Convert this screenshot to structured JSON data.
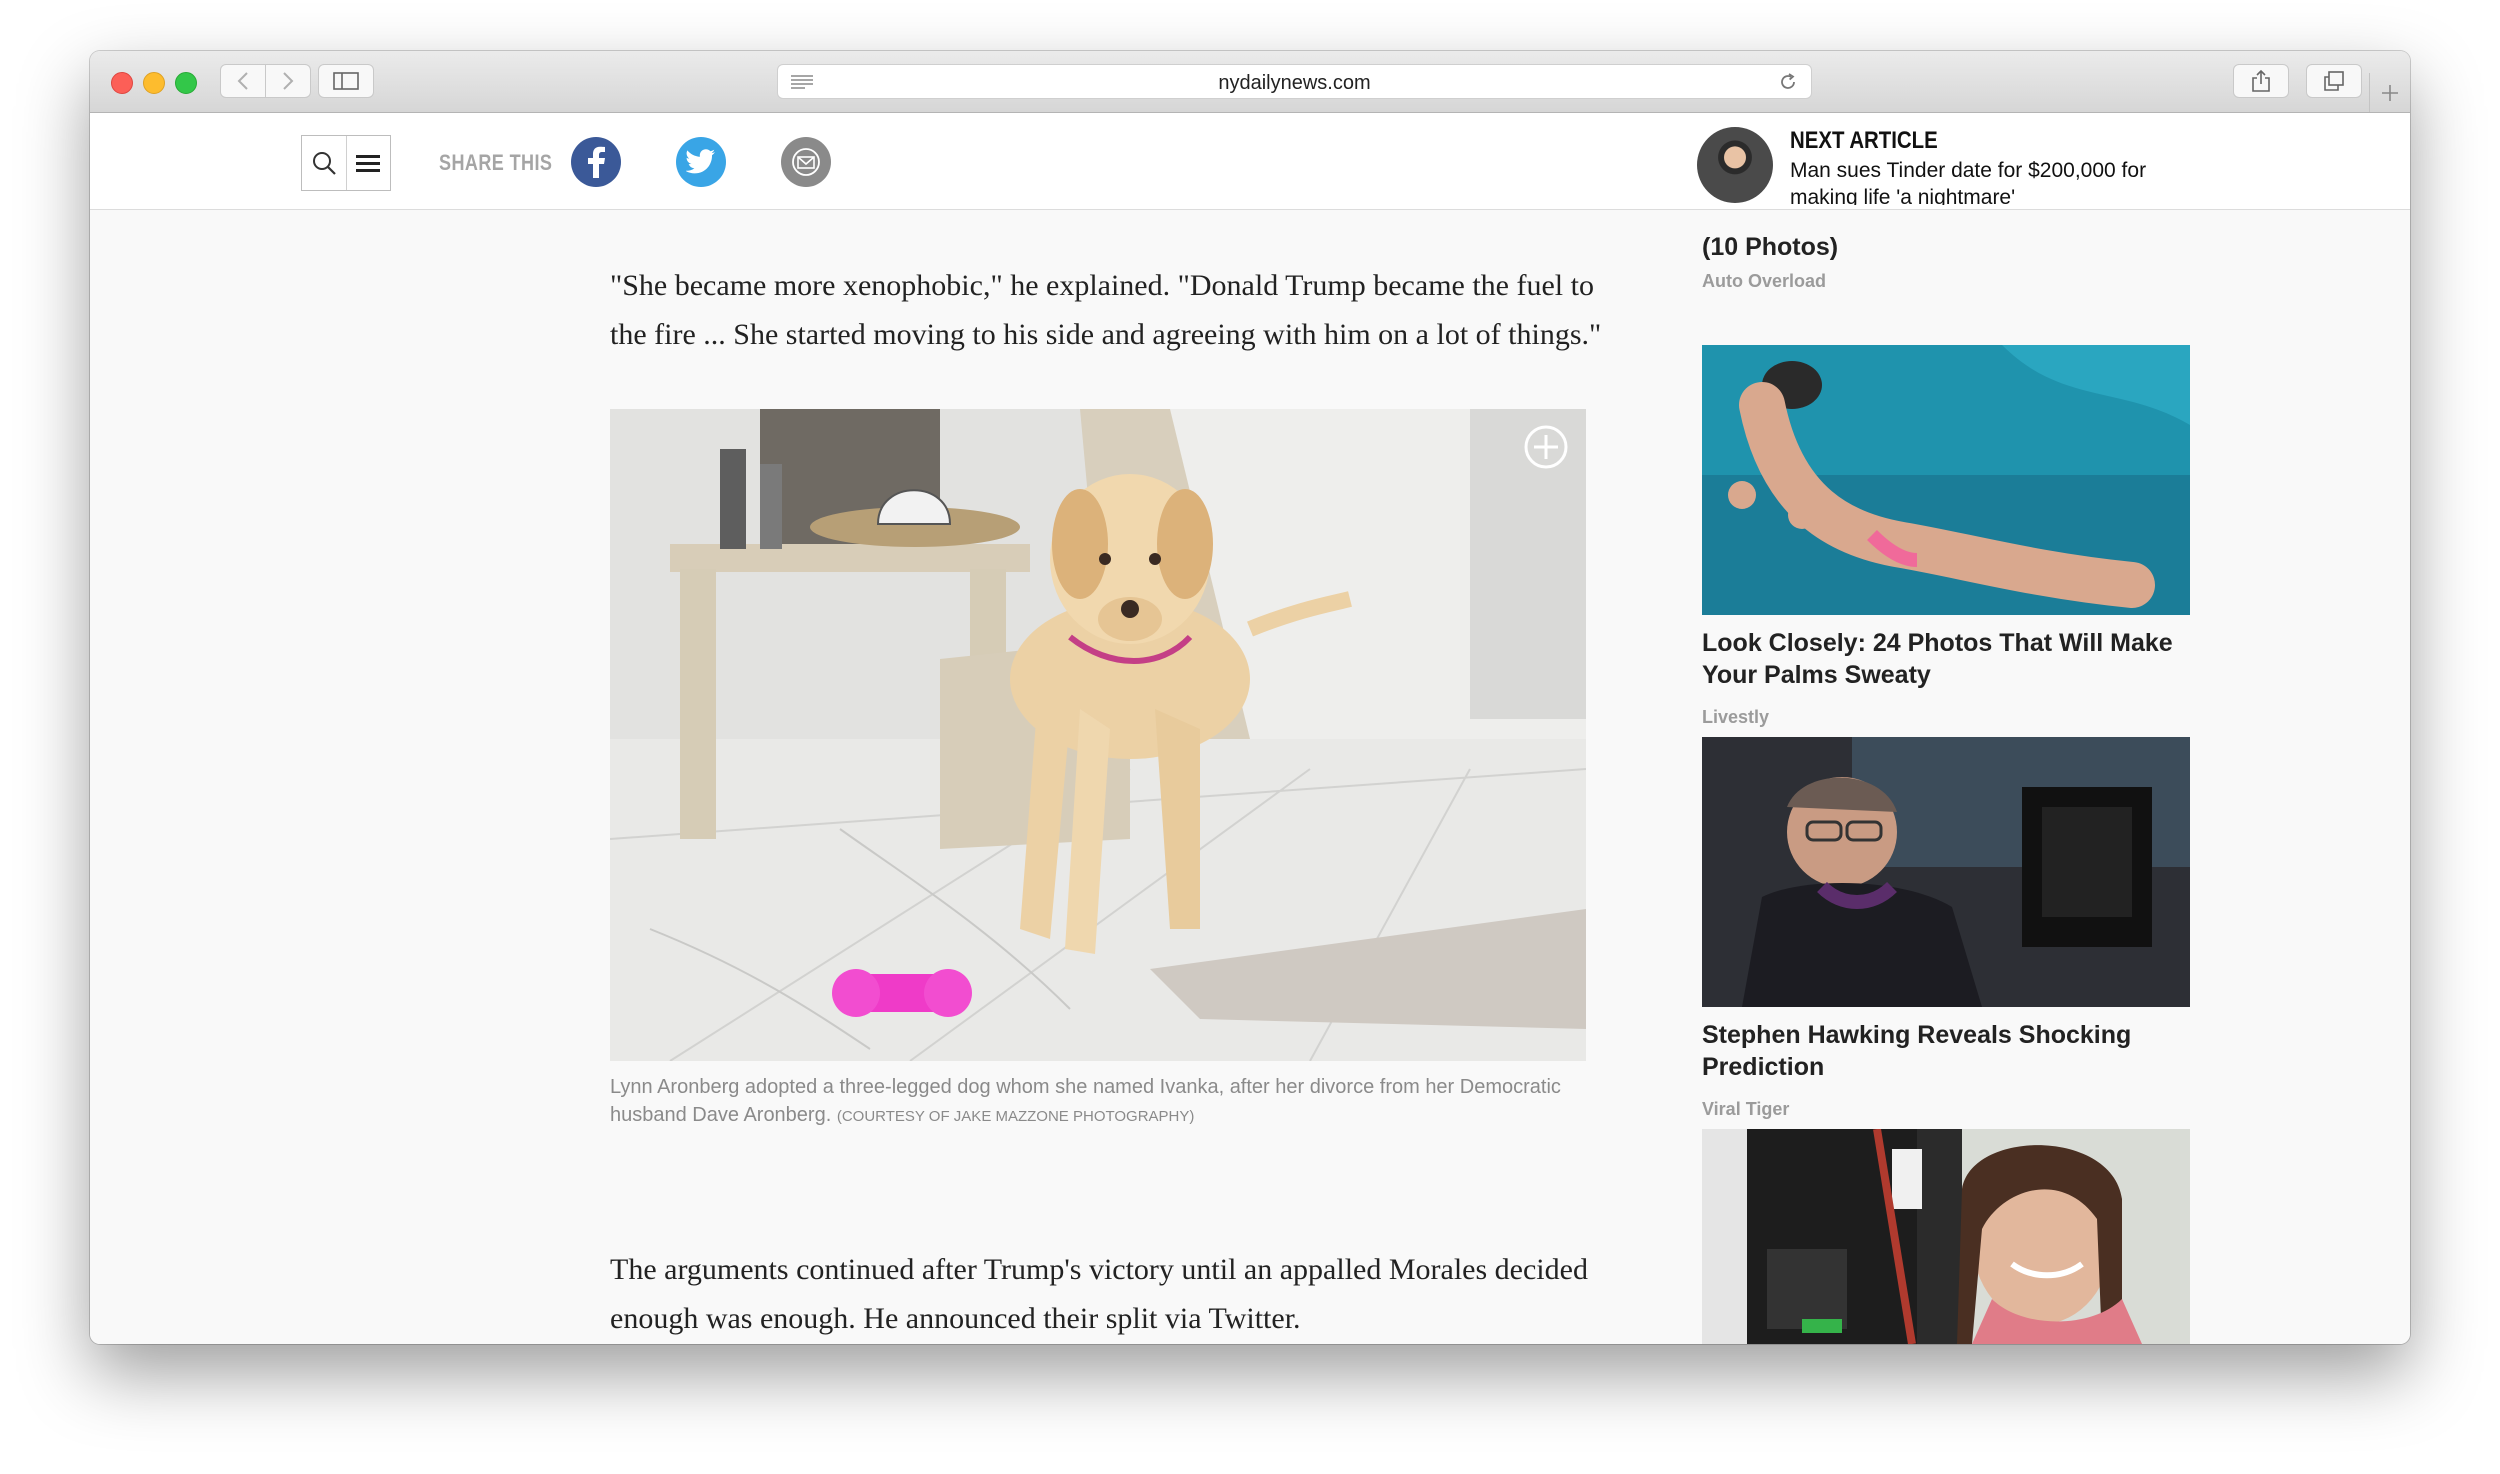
{
  "browser": {
    "url": "nydailynews.com"
  },
  "site_header": {
    "share_label": "SHARE THIS",
    "next_article_label": "NEXT ARTICLE",
    "next_article_title": "Man sues Tinder date for $200,000 for making life 'a nightmare'",
    "brand_colors": {
      "facebook": "#3b5998",
      "twitter": "#39a5e6",
      "email": "#8a8a8a"
    }
  },
  "article": {
    "paragraph_1": "\"She became more xenophobic,\" he explained. \"Donald Trump became the fuel to the fire ... She started moving to his side and agreeing with him on a lot of things.\"",
    "photo_caption": "Lynn Aronberg adopted a three-legged dog whom she named Ivanka, after her divorce from her Democratic husband Dave Aronberg.",
    "photo_credit": "(COURTESY OF JAKE MAZZONE PHOTOGRAPHY)",
    "paragraph_2": "The arguments continued after Trump's victory until an appalled Morales decided enough was enough. He announced their split via Twitter."
  },
  "sidebar": {
    "partial_item": {
      "title": "(10 Photos)",
      "source": "Auto Overload"
    },
    "items": [
      {
        "title": "Look Closely: 24 Photos That Will Make Your Palms Sweaty",
        "source": "Livestly"
      },
      {
        "title": "Stephen Hawking Reveals Shocking Prediction",
        "source": "Viral Tiger"
      }
    ]
  }
}
